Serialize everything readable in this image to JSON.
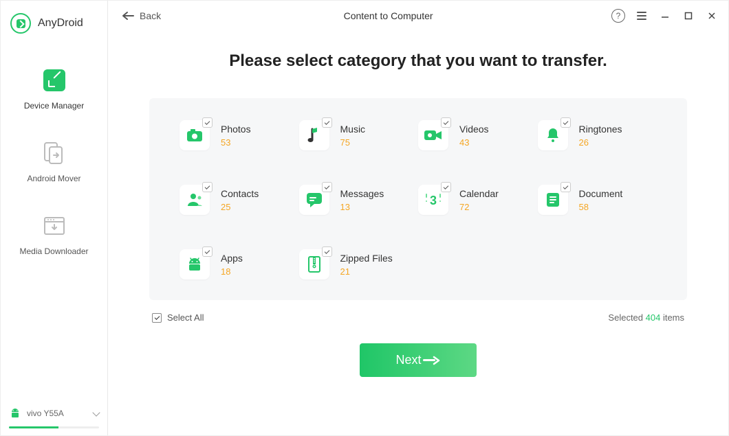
{
  "app": {
    "name": "AnyDroid"
  },
  "sidebar": {
    "items": [
      {
        "label": "Device Manager",
        "icon": "device-manager-icon",
        "active": true
      },
      {
        "label": "Android Mover",
        "icon": "android-mover-icon",
        "active": false
      },
      {
        "label": "Media Downloader",
        "icon": "media-downloader-icon",
        "active": false
      }
    ],
    "device": {
      "name": "vivo Y55A"
    }
  },
  "header": {
    "back_label": "Back",
    "page_title": "Content to Computer"
  },
  "main": {
    "heading": "Please select category that you want to transfer.",
    "categories": [
      {
        "id": "photos",
        "label": "Photos",
        "count": "53",
        "icon": "camera-icon"
      },
      {
        "id": "music",
        "label": "Music",
        "count": "75",
        "icon": "music-note-icon"
      },
      {
        "id": "videos",
        "label": "Videos",
        "count": "43",
        "icon": "video-camera-icon"
      },
      {
        "id": "ringtones",
        "label": "Ringtones",
        "count": "26",
        "icon": "bell-icon"
      },
      {
        "id": "contacts",
        "label": "Contacts",
        "count": "25",
        "icon": "person-icon"
      },
      {
        "id": "messages",
        "label": "Messages",
        "count": "13",
        "icon": "chat-bubble-icon"
      },
      {
        "id": "calendar",
        "label": "Calendar",
        "count": "72",
        "icon": "calendar-icon"
      },
      {
        "id": "document",
        "label": "Document",
        "count": "58",
        "icon": "document-icon"
      },
      {
        "id": "apps",
        "label": "Apps",
        "count": "18",
        "icon": "android-robot-icon"
      },
      {
        "id": "zipped",
        "label": "Zipped Files",
        "count": "21",
        "icon": "zip-file-icon"
      }
    ],
    "select_all_label": "Select All",
    "selected_prefix": "Selected ",
    "selected_count": "404",
    "selected_suffix": " items",
    "next_label": "Next"
  }
}
